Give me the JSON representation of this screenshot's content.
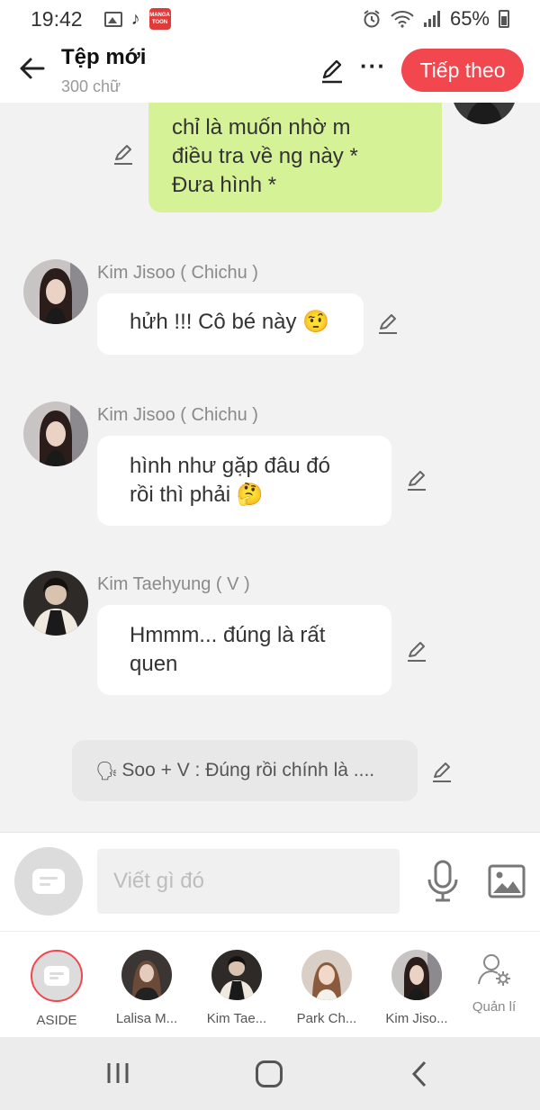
{
  "status_bar": {
    "time": "19:42",
    "app_badge": "MANGA TOON",
    "battery": "65%"
  },
  "header": {
    "title": "Tệp mới",
    "subtitle": "300 chữ",
    "next_label": "Tiếp theo"
  },
  "messages": {
    "m0": {
      "text_lines": [
        "chỉ là muốn nhờ m",
        "điều tra về ng này *",
        "Đưa hình *"
      ]
    },
    "m1": {
      "name": "Kim Jisoo ( Chichu )",
      "text": "hửh !!! Cô bé này 🤨"
    },
    "m2": {
      "name": "Kim Jisoo ( Chichu )",
      "text_lines": [
        "hình như gặp đâu đó",
        "rồi thì phải 🤔"
      ]
    },
    "m3": {
      "name": "Kim Taehyung ( V )",
      "text_lines": [
        "Hmmm... đúng là rất",
        "quen"
      ]
    },
    "narration": "Soo + V : Đúng rồi chính là ...."
  },
  "input": {
    "placeholder": "Viết gì đó"
  },
  "characters": [
    {
      "label": "ASIDE"
    },
    {
      "label": "Lalisa M..."
    },
    {
      "label": "Kim Tae..."
    },
    {
      "label": "Park Ch..."
    },
    {
      "label": "Kim Jiso..."
    },
    {
      "label": "Quản lí"
    }
  ],
  "colors": {
    "accent": "#f2474e",
    "self_bubble": "#d6f296",
    "chat_bg": "#f2f2f2"
  },
  "icons": [
    "back-arrow-icon",
    "pencil-icon",
    "more-icon",
    "mic-icon",
    "image-icon",
    "aside-message-icon",
    "manage-user-icon",
    "nav-recent-icon",
    "nav-home-icon",
    "nav-back-icon"
  ]
}
